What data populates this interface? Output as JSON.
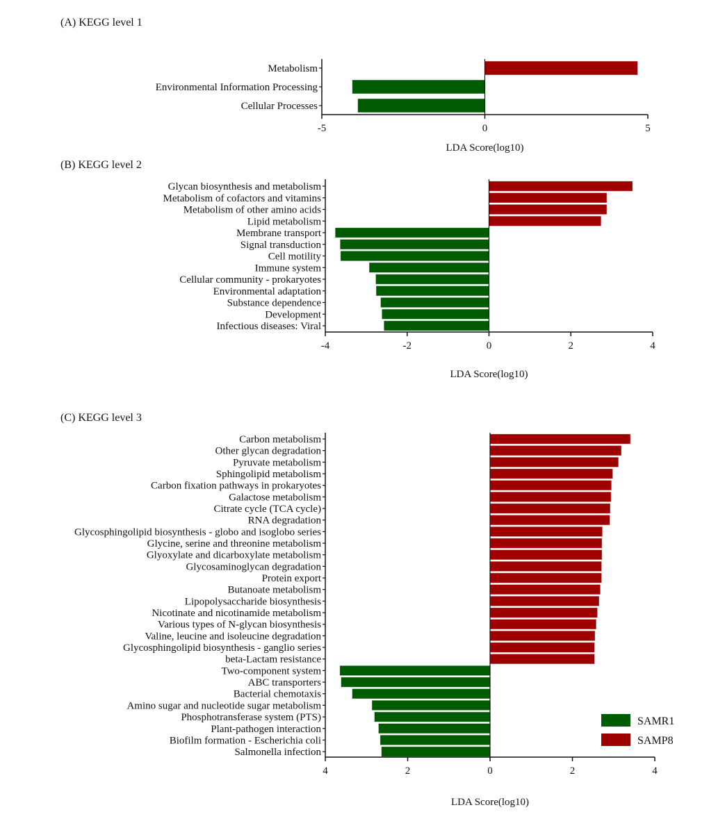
{
  "colors": {
    "SAMR1": "#005a00",
    "SAMP8": "#9e0000"
  },
  "legend": {
    "placement": "bottom-right of panel C",
    "items": [
      {
        "label": "SAMR1",
        "group": "SAMR1"
      },
      {
        "label": "SAMP8",
        "group": "SAMP8"
      }
    ]
  },
  "chart_data": [
    {
      "type": "bar",
      "orientation": "horizontal",
      "title": "(A) KEGG level 1",
      "xlabel": "LDA Score(log10)",
      "ylabel": "",
      "xlim": [
        -5,
        5
      ],
      "xticks": [
        -5,
        0,
        5
      ],
      "xtick_labels": [
        "-5",
        "0",
        "5"
      ],
      "grid": false,
      "categories": [
        "Metabolism",
        "Environmental Information Processing",
        "Cellular Processes"
      ],
      "values": [
        4.69,
        -4.07,
        -3.9
      ],
      "groups": [
        "SAMP8",
        "SAMR1",
        "SAMR1"
      ]
    },
    {
      "type": "bar",
      "orientation": "horizontal",
      "title": "(B) KEGG level 2",
      "xlabel": "LDA Score(log10)",
      "ylabel": "",
      "xlim": [
        -4,
        4
      ],
      "xticks": [
        -4,
        -2,
        0,
        2,
        4
      ],
      "xtick_labels": [
        "-4",
        "-2",
        "0",
        "2",
        "4"
      ],
      "grid": false,
      "categories": [
        "Glycan biosynthesis and metabolism",
        "Metabolism of cofactors and vitamins",
        "Metabolism of other amino acids",
        "Lipid metabolism",
        "Membrane transport",
        "Signal transduction",
        "Cell motility",
        "Immune system",
        "Cellular community - prokaryotes",
        "Environmental adaptation",
        "Substance dependence",
        "Development",
        "Infectious diseases: Viral"
      ],
      "values": [
        3.51,
        2.88,
        2.88,
        2.74,
        -3.76,
        -3.64,
        -3.63,
        -2.93,
        -2.77,
        -2.76,
        -2.65,
        -2.62,
        -2.57
      ],
      "groups": [
        "SAMP8",
        "SAMP8",
        "SAMP8",
        "SAMP8",
        "SAMR1",
        "SAMR1",
        "SAMR1",
        "SAMR1",
        "SAMR1",
        "SAMR1",
        "SAMR1",
        "SAMR1",
        "SAMR1"
      ]
    },
    {
      "type": "bar",
      "orientation": "horizontal",
      "title": "(C) KEGG level 3",
      "xlabel": "LDA Score(log10)",
      "ylabel": "",
      "xlim": [
        -4,
        4
      ],
      "xticks": [
        -4,
        -2,
        0,
        2,
        4
      ],
      "xtick_labels": [
        "4",
        "2",
        "0",
        "2",
        "4"
      ],
      "grid": false,
      "categories": [
        "Carbon metabolism",
        "Other glycan degradation",
        "Pyruvate metabolism",
        "Sphingolipid metabolism",
        "Carbon fixation pathways in prokaryotes",
        "Galactose metabolism",
        "Citrate cycle (TCA cycle)",
        "RNA degradation",
        "Glycosphingolipid biosynthesis - globo and isoglobo series",
        "Glycine, serine and threonine metabolism",
        "Glyoxylate and dicarboxylate metabolism",
        "Glycosaminoglycan degradation",
        "Protein export",
        "Butanoate metabolism",
        "Lipopolysaccharide biosynthesis",
        "Nicotinate and nicotinamide metabolism",
        "Various types of N-glycan biosynthesis",
        "Valine, leucine and isoleucine degradation",
        "Glycosphingolipid biosynthesis - ganglio series",
        "beta-Lactam resistance",
        "Two-component system",
        "ABC transporters",
        "Bacterial chemotaxis",
        "Amino sugar and nucleotide sugar metabolism",
        "Phosphotransferase system (PTS)",
        "Plant-pathogen interaction",
        "Biofilm formation - Escherichia coli",
        "Salmonella infection"
      ],
      "values": [
        3.41,
        3.19,
        3.12,
        2.98,
        2.95,
        2.94,
        2.92,
        2.91,
        2.73,
        2.72,
        2.72,
        2.71,
        2.71,
        2.68,
        2.65,
        2.61,
        2.58,
        2.55,
        2.54,
        2.54,
        -3.65,
        -3.62,
        -3.35,
        -2.87,
        -2.81,
        -2.71,
        -2.67,
        -2.64
      ],
      "groups": [
        "SAMP8",
        "SAMP8",
        "SAMP8",
        "SAMP8",
        "SAMP8",
        "SAMP8",
        "SAMP8",
        "SAMP8",
        "SAMP8",
        "SAMP8",
        "SAMP8",
        "SAMP8",
        "SAMP8",
        "SAMP8",
        "SAMP8",
        "SAMP8",
        "SAMP8",
        "SAMP8",
        "SAMP8",
        "SAMP8",
        "SAMR1",
        "SAMR1",
        "SAMR1",
        "SAMR1",
        "SAMR1",
        "SAMR1",
        "SAMR1",
        "SAMR1"
      ]
    }
  ]
}
